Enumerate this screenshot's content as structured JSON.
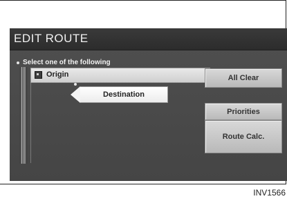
{
  "screen": {
    "title": "EDIT ROUTE",
    "instruction": "Select one of the following"
  },
  "list": {
    "origin_label": "Origin",
    "destination_label": "Destination"
  },
  "buttons": {
    "all_clear": "All Clear",
    "priorities": "Priorities",
    "route_calc": "Route Calc."
  },
  "caption": "INV1566",
  "icons": {
    "origin": "flag-icon",
    "destination_pointer": "arrow-left-icon"
  }
}
